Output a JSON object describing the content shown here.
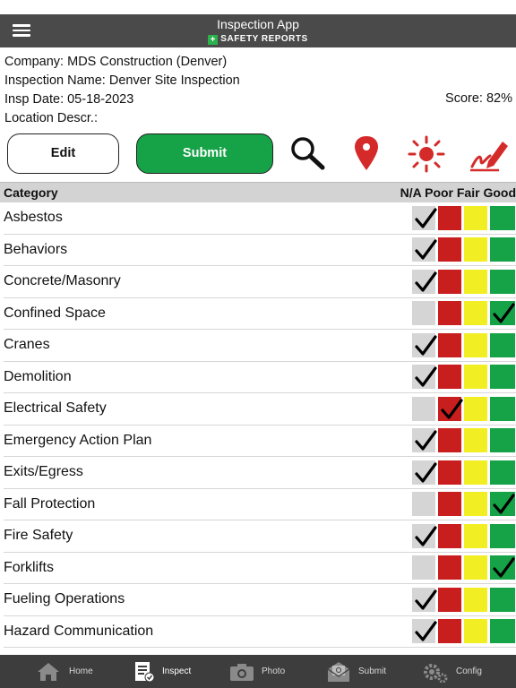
{
  "header": {
    "title": "Inspection App",
    "brand": "SAFETY REPORTS",
    "brand_cross": "+"
  },
  "info": {
    "company": "Company: MDS Construction (Denver)",
    "inspection_name": "Inspection Name: Denver Site Inspection",
    "insp_date": "Insp Date: 05-18-2023",
    "location": "Location Descr.:",
    "score": "Score: 82%"
  },
  "actions": {
    "edit_label": "Edit",
    "submit_label": "Submit",
    "icons": [
      "search-icon",
      "location-pin-icon",
      "sun-icon",
      "signature-icon"
    ]
  },
  "table": {
    "category_header": "Category",
    "rating_header": "N/A Poor Fair Good",
    "rows": [
      {
        "name": "Asbestos",
        "rating": "na"
      },
      {
        "name": "Behaviors",
        "rating": "na"
      },
      {
        "name": "Concrete/Masonry",
        "rating": "na"
      },
      {
        "name": "Confined Space",
        "rating": "good"
      },
      {
        "name": "Cranes",
        "rating": "na"
      },
      {
        "name": "Demolition",
        "rating": "na"
      },
      {
        "name": "Electrical Safety",
        "rating": "poor"
      },
      {
        "name": "Emergency Action Plan",
        "rating": "na"
      },
      {
        "name": "Exits/Egress",
        "rating": "na"
      },
      {
        "name": "Fall Protection",
        "rating": "good"
      },
      {
        "name": "Fire Safety",
        "rating": "na"
      },
      {
        "name": "Forklifts",
        "rating": "good"
      },
      {
        "name": "Fueling Operations",
        "rating": "na"
      },
      {
        "name": "Hazard Communication",
        "rating": "na"
      }
    ]
  },
  "tabbar": {
    "tabs": [
      {
        "label": "Home",
        "icon": "home-icon"
      },
      {
        "label": "Inspect",
        "icon": "clipboard-check-icon",
        "active": true
      },
      {
        "label": "Photo",
        "icon": "camera-icon"
      },
      {
        "label": "Submit",
        "icon": "envelope-icon"
      },
      {
        "label": "Config",
        "icon": "gears-icon"
      }
    ]
  },
  "colors": {
    "header_bg": "#4a4a4a",
    "submit_green": "#16a247",
    "poor_red": "#c81e1e",
    "fair_yellow": "#f1ee24",
    "na_gray": "#d5d5d5",
    "icon_red": "#d42a2a"
  }
}
